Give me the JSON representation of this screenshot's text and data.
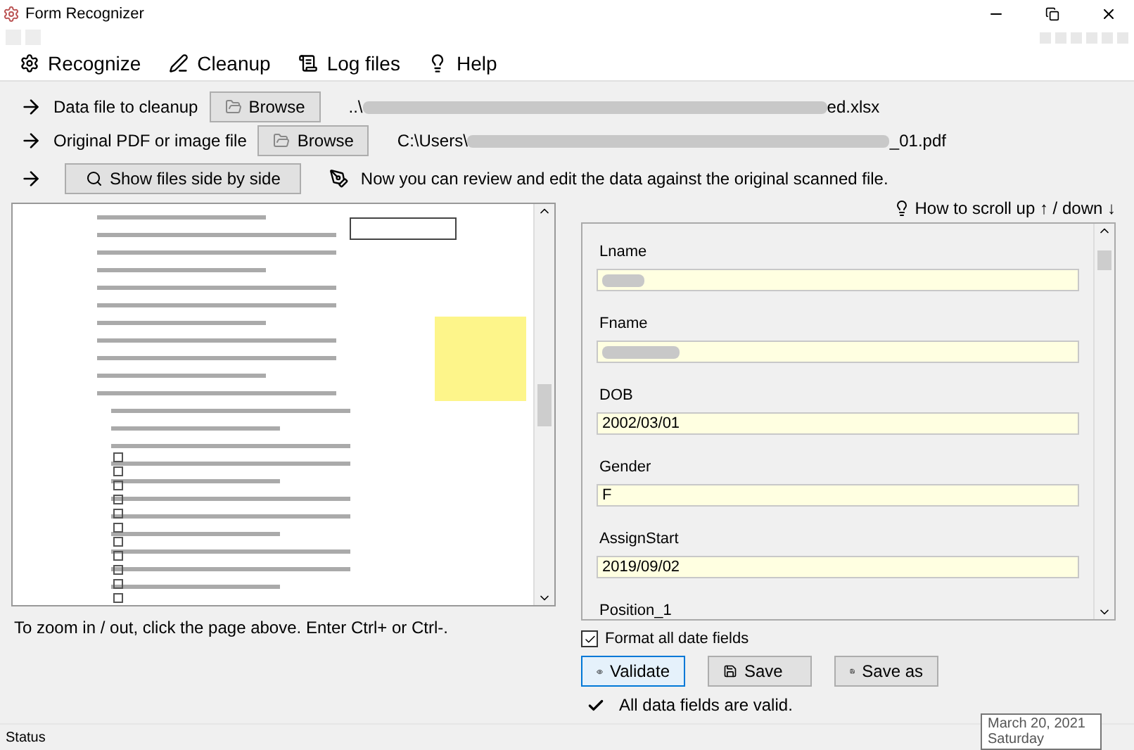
{
  "window": {
    "title": "Form Recognizer"
  },
  "menu": [
    {
      "kind": "gear",
      "label": "Recognize"
    },
    {
      "kind": "pen",
      "label": "Cleanup"
    },
    {
      "kind": "scroll",
      "label": "Log files"
    },
    {
      "kind": "bulb",
      "label": "Help"
    }
  ],
  "file_rows": [
    {
      "label": "Data file to cleanup",
      "button": "Browse",
      "path_start": "..\\",
      "path_end": "ed.xlsx"
    },
    {
      "label": "Original PDF or image file",
      "button": "Browse",
      "path_start": "C:\\Users\\",
      "path_end": "_01.pdf"
    }
  ],
  "side_by_side_button": "Show files side by side",
  "review_note": "Now you can review and edit the data against the original scanned file.",
  "scroll_help": "How to scroll up ↑ / down ↓",
  "fields": [
    {
      "label": "Lname",
      "redacted": true
    },
    {
      "label": "Fname",
      "redacted": true
    },
    {
      "label": "DOB",
      "value": "2002/03/01",
      "redacted": false
    },
    {
      "label": "Gender",
      "value": "F",
      "redacted": false
    },
    {
      "label": "AssignStart",
      "value": "2019/09/02",
      "redacted": false
    }
  ],
  "partial_field_label": "Position_1",
  "zoom_hint": "To zoom in / out, click the page above.  Enter Ctrl+ or Ctrl-.",
  "format_dates": {
    "label": "Format all date fields",
    "checked": true
  },
  "actions": [
    {
      "kind": "eye",
      "label": "Validate",
      "selected": true
    },
    {
      "kind": "disk",
      "label": "Save",
      "selected": false
    },
    {
      "kind": "disk",
      "label": "Save as",
      "selected": false
    }
  ],
  "validation_message": "All data fields are valid.",
  "status_bar": "Status",
  "tooltip": {
    "date": "March 20, 2021",
    "day": "Saturday"
  }
}
